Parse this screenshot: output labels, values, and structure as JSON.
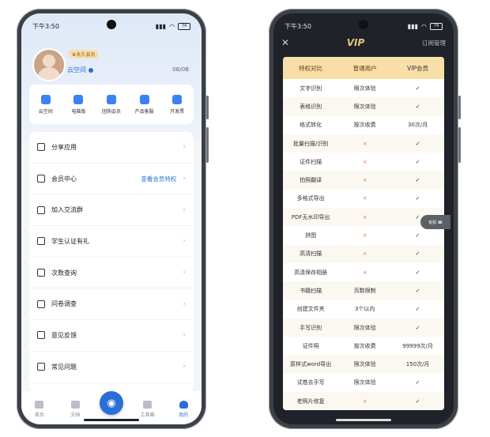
{
  "left_phone": {
    "status": {
      "time": "下午3:50",
      "battery": "74"
    },
    "profile": {
      "badge": "♛永久会员",
      "username": "云空间",
      "storage": "0B/0B"
    },
    "quick_actions": [
      {
        "label": "云空间",
        "icon": "cloud-icon"
      },
      {
        "label": "电脑版",
        "icon": "monitor-icon"
      },
      {
        "label": "团购会员",
        "icon": "diamond-icon"
      },
      {
        "label": "产品客服",
        "icon": "headset-icon"
      },
      {
        "label": "开发票",
        "icon": "invoice-icon"
      }
    ],
    "menu": [
      {
        "label": "分享应用",
        "extra": "",
        "icon": "share-icon"
      },
      {
        "label": "会员中心",
        "extra": "查看会员特权",
        "icon": "diamond-icon"
      },
      {
        "label": "加入交流群",
        "extra": "",
        "icon": "group-icon"
      },
      {
        "label": "学生认证有礼",
        "extra": "",
        "icon": "graduation-cap-icon"
      },
      {
        "label": "次数查询",
        "extra": "",
        "icon": "search-count-icon"
      },
      {
        "label": "问卷调查",
        "extra": "",
        "icon": "survey-icon"
      },
      {
        "label": "意见反馈",
        "extra": "",
        "icon": "feedback-icon"
      },
      {
        "label": "常见问题",
        "extra": "",
        "icon": "question-icon"
      }
    ],
    "tabs": [
      {
        "label": "首页",
        "icon": "home-icon"
      },
      {
        "label": "文档",
        "icon": "folder-icon"
      },
      {
        "label": "",
        "icon": "camera-icon"
      },
      {
        "label": "工具箱",
        "icon": "toolbox-icon"
      },
      {
        "label": "我的",
        "icon": "user-icon"
      }
    ],
    "accent": "#2a6fd6"
  },
  "right_phone": {
    "status": {
      "time": "下午3:50",
      "battery": "74"
    },
    "header": {
      "close": "✕",
      "title": "VIP",
      "manage": "订阅管理"
    },
    "table": {
      "headers": [
        "特权对比",
        "普通用户",
        "VIP会员"
      ],
      "rows": [
        [
          "文字识别",
          "限次体验",
          "✓"
        ],
        [
          "表格识别",
          "限次体验",
          "✓"
        ],
        [
          "格式转化",
          "按次收费",
          "30次/月"
        ],
        [
          "批量扫描/识别",
          "×",
          "✓"
        ],
        [
          "证件扫描",
          "×",
          "✓"
        ],
        [
          "拍照翻译",
          "×",
          "✓"
        ],
        [
          "多格式导出",
          "×",
          "✓"
        ],
        [
          "PDF无水印导出",
          "×",
          "✓"
        ],
        [
          "拼图",
          "×",
          "✓"
        ],
        [
          "高清扫描",
          "×",
          "✓"
        ],
        [
          "高清保存相册",
          "×",
          "✓"
        ],
        [
          "书籍扫描",
          "页数限制",
          "✓"
        ],
        [
          "创建文件夹",
          "3个以内",
          "✓"
        ],
        [
          "手写识别",
          "限次体验",
          "✓"
        ],
        [
          "证件照",
          "按次收费",
          "99999次/月"
        ],
        [
          "原样式word导出",
          "限次体验",
          "150次/月"
        ],
        [
          "试卷去手写",
          "限次体验",
          "✓"
        ],
        [
          "老照片修复",
          "×",
          "✓"
        ]
      ]
    },
    "floating_button": "客服 ☎",
    "header_color": "#f8dfa8"
  }
}
